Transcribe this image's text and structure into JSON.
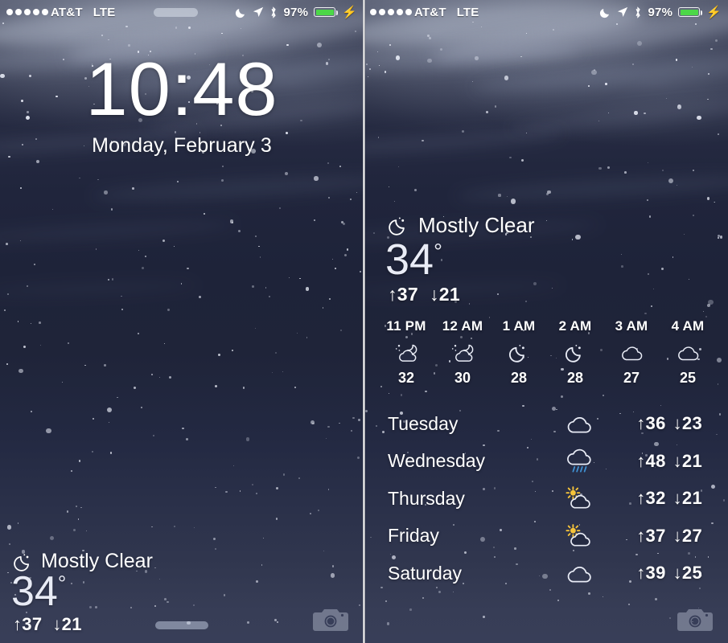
{
  "status_bar": {
    "signal_dots": 5,
    "carrier": "AT&T",
    "network": "LTE",
    "icons": [
      "moon-dnd-icon",
      "location-arrow-icon",
      "bluetooth-icon"
    ],
    "battery_percent": "97%",
    "battery_color": "#4cd748",
    "charging": true
  },
  "lock_screen": {
    "time": "10:48",
    "time_hours": "10",
    "time_colon": ":",
    "time_minutes": "48",
    "date": "Monday, February 3",
    "weather": {
      "icon": "moon-clear-icon",
      "condition": "Mostly Clear",
      "temperature": "34",
      "degree": "°",
      "high": "↑37",
      "low": "↓21"
    },
    "grabber": "home-grabber",
    "camera_shortcut": "camera-icon"
  },
  "notification_center": {
    "weather": {
      "icon": "moon-clear-icon",
      "condition": "Mostly Clear",
      "temperature": "34",
      "degree": "°",
      "high": "↑37",
      "low": "↓21"
    },
    "hourly": [
      {
        "time": "11 PM",
        "icon": "moon-cloud-icon",
        "temp": "32"
      },
      {
        "time": "12 AM",
        "icon": "moon-cloud-icon",
        "temp": "30"
      },
      {
        "time": "1 AM",
        "icon": "moon-icon",
        "temp": "28"
      },
      {
        "time": "2 AM",
        "icon": "moon-icon",
        "temp": "28"
      },
      {
        "time": "3 AM",
        "icon": "cloud-icon",
        "temp": "27"
      },
      {
        "time": "4 AM",
        "icon": "cloud-icon",
        "temp": "25"
      }
    ],
    "daily": [
      {
        "day": "Tuesday",
        "icon": "cloud-icon",
        "high": "↑36",
        "low": "↓23"
      },
      {
        "day": "Wednesday",
        "icon": "rain-icon",
        "high": "↑48",
        "low": "↓21"
      },
      {
        "day": "Thursday",
        "icon": "sun-cloud-icon",
        "high": "↑32",
        "low": "↓21"
      },
      {
        "day": "Friday",
        "icon": "sun-cloud-icon",
        "high": "↑37",
        "low": "↓27"
      },
      {
        "day": "Saturday",
        "icon": "cloud-icon",
        "high": "↑39",
        "low": "↓25"
      }
    ],
    "camera_shortcut": "camera-icon"
  },
  "theme": {
    "wallpaper_top": "#454a5e",
    "wallpaper_mid": "#1e2339",
    "wallpaper_bottom": "#383e58",
    "text": "#ffffff",
    "rain_color": "#3f8fd0",
    "sun_color": "#f5c33a"
  }
}
